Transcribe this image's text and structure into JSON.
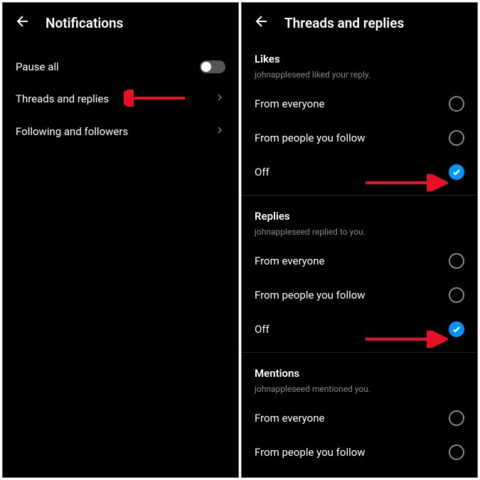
{
  "left": {
    "title": "Notifications",
    "items": [
      {
        "label": "Pause all",
        "type": "toggle"
      },
      {
        "label": "Threads and replies",
        "type": "nav"
      },
      {
        "label": "Following and followers",
        "type": "nav"
      }
    ]
  },
  "right": {
    "title": "Threads and replies",
    "sections": [
      {
        "title": "Likes",
        "subtitle": "johnappleseed liked your reply.",
        "options": [
          {
            "label": "From everyone",
            "selected": false
          },
          {
            "label": "From people you follow",
            "selected": false
          },
          {
            "label": "Off",
            "selected": true
          }
        ]
      },
      {
        "title": "Replies",
        "subtitle": "johnappleseed replied to you.",
        "options": [
          {
            "label": "From everyone",
            "selected": false
          },
          {
            "label": "From people you follow",
            "selected": false
          },
          {
            "label": "Off",
            "selected": true
          }
        ]
      },
      {
        "title": "Mentions",
        "subtitle": "johnappleseed mentioned you.",
        "options": [
          {
            "label": "From everyone",
            "selected": false
          },
          {
            "label": "From people you follow",
            "selected": false
          }
        ]
      }
    ]
  },
  "colors": {
    "accent": "#0095f6",
    "arrow": "#e81123"
  }
}
